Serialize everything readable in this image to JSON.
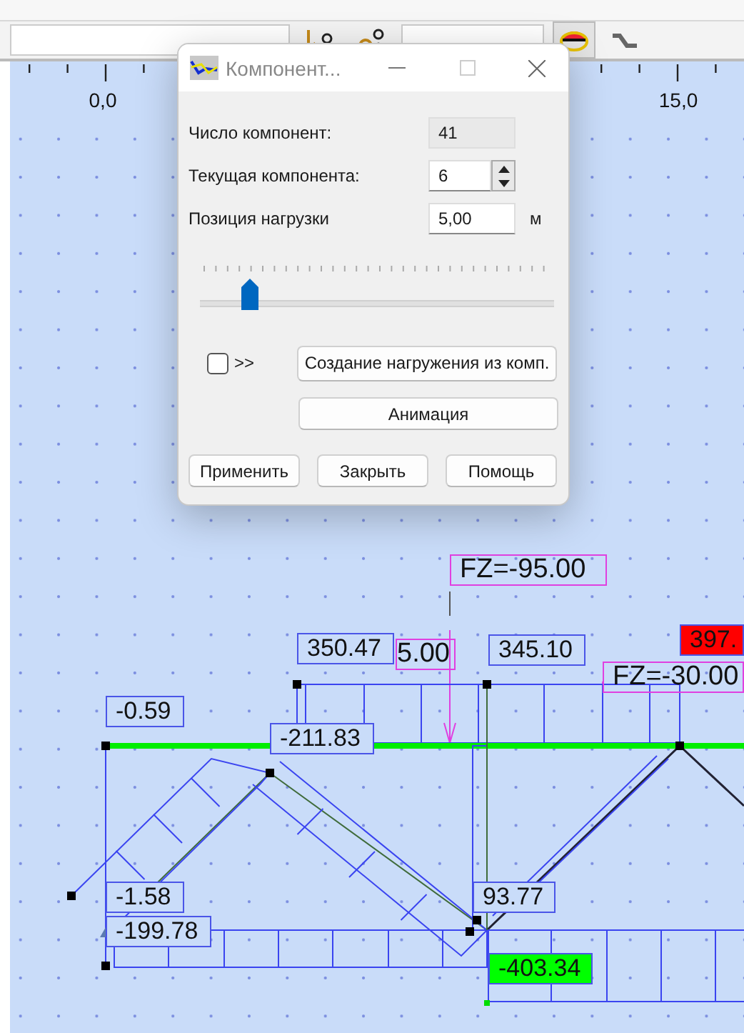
{
  "ruler": {
    "labels": [
      "0,0",
      "15,0"
    ]
  },
  "dialog": {
    "title": "Компонент...",
    "fields": [
      {
        "kind": "readonly",
        "label": "Число компонент:",
        "value": "41"
      },
      {
        "kind": "spinner",
        "label": "Текущая компонента:",
        "value": "6"
      },
      {
        "kind": "input",
        "label": "Позиция нагрузки",
        "value": "5,00",
        "unit": "м"
      }
    ],
    "slider": {
      "level": 0.14
    },
    "checkbox": {
      "checked": false,
      "label": ">>"
    },
    "create_button": "Создание нагружения из комп.",
    "animate_button": "Анимация",
    "buttons": [
      "Применить",
      "Закрыть",
      "Помощь"
    ]
  },
  "diagram": {
    "labels": [
      {
        "kind": "load",
        "text": "FZ=-95.00"
      },
      {
        "kind": "result",
        "text": "350.47"
      },
      {
        "kind": "load",
        "text": "5.00"
      },
      {
        "kind": "result",
        "text": "345.10"
      },
      {
        "kind": "max",
        "text": "397."
      },
      {
        "kind": "load",
        "text": "FZ=-30.00"
      },
      {
        "kind": "result",
        "text": "-0.59"
      },
      {
        "kind": "result",
        "text": "-211.83"
      },
      {
        "kind": "result",
        "text": "-1.58"
      },
      {
        "kind": "result",
        "text": "-199.78"
      },
      {
        "kind": "result",
        "text": "93.77"
      },
      {
        "kind": "min",
        "text": "-403.34"
      }
    ]
  }
}
